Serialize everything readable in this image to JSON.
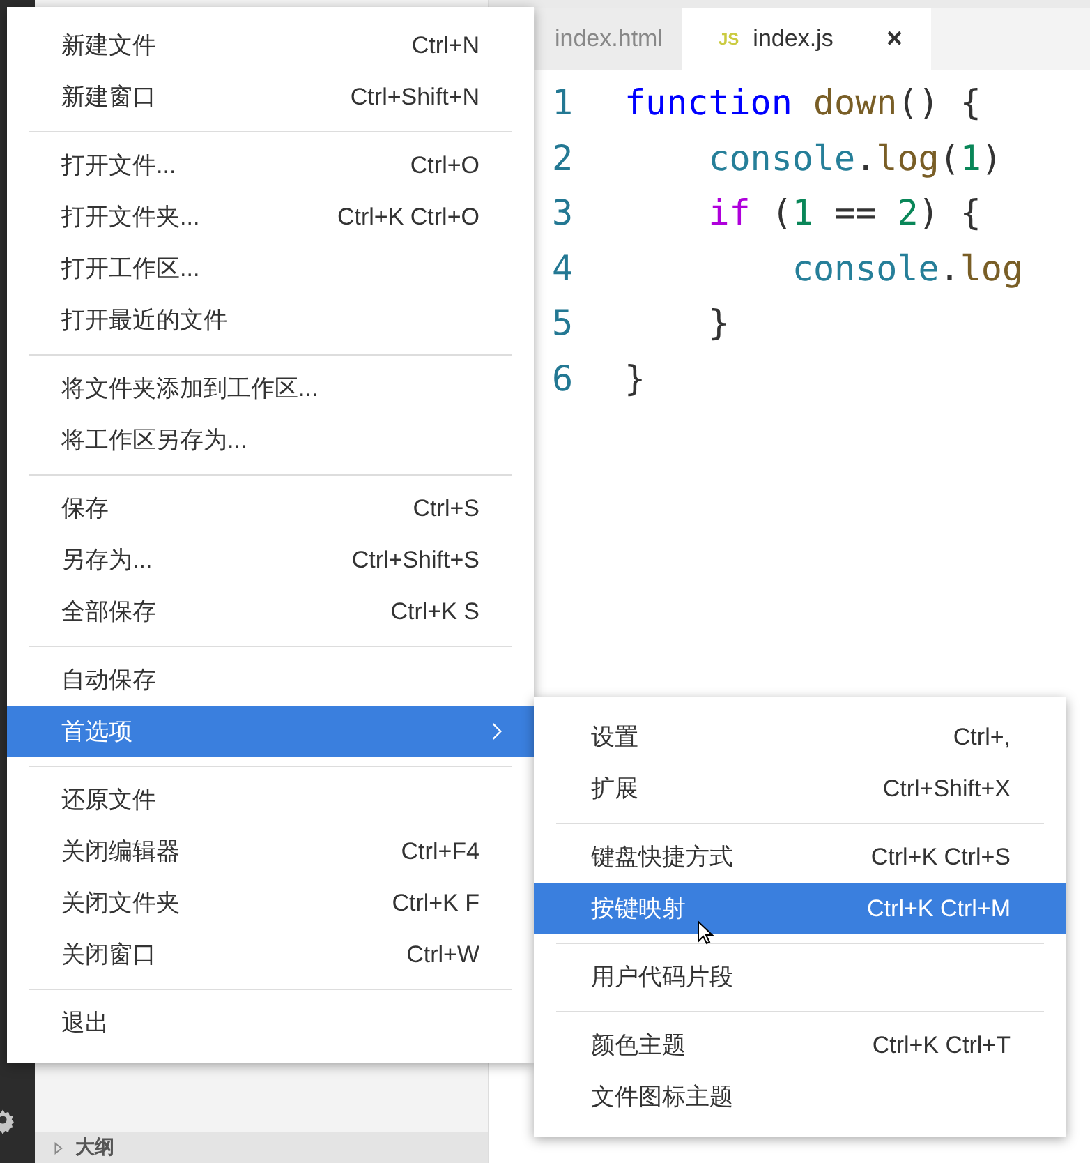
{
  "editor": {
    "tabs": [
      {
        "label": "index.html",
        "selected": false
      },
      {
        "badge": "JS",
        "label": "index.js",
        "selected": true,
        "close": "×"
      }
    ],
    "lines": [
      {
        "number": "1",
        "tokens": [
          {
            "kind": "keyword",
            "text": "function "
          },
          {
            "kind": "function",
            "text": "down"
          },
          {
            "kind": "punct",
            "text": "() {"
          }
        ]
      },
      {
        "number": "2",
        "tokens": [
          {
            "kind": "variable",
            "text": "    console"
          },
          {
            "kind": "punct",
            "text": "."
          },
          {
            "kind": "function",
            "text": "log"
          },
          {
            "kind": "punct",
            "text": "("
          },
          {
            "kind": "number",
            "text": "1"
          },
          {
            "kind": "punct",
            "text": ")"
          }
        ]
      },
      {
        "number": "3",
        "tokens": [
          {
            "kind": "control",
            "text": "    if"
          },
          {
            "kind": "punct",
            "text": " ("
          },
          {
            "kind": "number",
            "text": "1"
          },
          {
            "kind": "punct",
            "text": " == "
          },
          {
            "kind": "number",
            "text": "2"
          },
          {
            "kind": "punct",
            "text": ") {"
          }
        ]
      },
      {
        "number": "4",
        "tokens": [
          {
            "kind": "variable",
            "text": "        console"
          },
          {
            "kind": "punct",
            "text": "."
          },
          {
            "kind": "function",
            "text": "log"
          }
        ]
      },
      {
        "number": "5",
        "tokens": [
          {
            "kind": "punct",
            "text": "    }"
          }
        ]
      },
      {
        "number": "6",
        "tokens": [
          {
            "kind": "punct",
            "text": "}"
          }
        ]
      }
    ]
  },
  "sidebar": {
    "section": {
      "label": "大纲",
      "expanded": false
    }
  },
  "menu": {
    "groups": [
      [
        {
          "label": "新建文件",
          "shortcut": "Ctrl+N",
          "selected": false
        },
        {
          "label": "新建窗口",
          "shortcut": "Ctrl+Shift+N",
          "selected": false
        }
      ],
      [
        {
          "label": "打开文件...",
          "shortcut": "Ctrl+O",
          "selected": false
        },
        {
          "label": "打开文件夹...",
          "shortcut": "Ctrl+K Ctrl+O",
          "selected": false
        },
        {
          "label": "打开工作区...",
          "selected": false
        },
        {
          "label": "打开最近的文件",
          "selected": false
        }
      ],
      [
        {
          "label": "将文件夹添加到工作区...",
          "selected": false
        },
        {
          "label": "将工作区另存为...",
          "selected": false
        }
      ],
      [
        {
          "label": "保存",
          "shortcut": "Ctrl+S",
          "selected": false
        },
        {
          "label": "另存为...",
          "shortcut": "Ctrl+Shift+S",
          "selected": false
        },
        {
          "label": "全部保存",
          "shortcut": "Ctrl+K S",
          "selected": false
        }
      ],
      [
        {
          "label": "自动保存",
          "selected": false
        },
        {
          "label": "首选项",
          "selected": true,
          "submenu": true
        }
      ],
      [
        {
          "label": "还原文件",
          "selected": false
        },
        {
          "label": "关闭编辑器",
          "shortcut": "Ctrl+F4",
          "selected": false
        },
        {
          "label": "关闭文件夹",
          "shortcut": "Ctrl+K F",
          "selected": false
        },
        {
          "label": "关闭窗口",
          "shortcut": "Ctrl+W",
          "selected": false
        }
      ],
      [
        {
          "label": "退出",
          "selected": false
        }
      ]
    ]
  },
  "submenu": {
    "groups": [
      [
        {
          "label": "设置",
          "shortcut": "Ctrl+,",
          "selected": false
        },
        {
          "label": "扩展",
          "shortcut": "Ctrl+Shift+X",
          "selected": false
        }
      ],
      [
        {
          "label": "键盘快捷方式",
          "shortcut": "Ctrl+K Ctrl+S",
          "selected": false
        },
        {
          "label": "按键映射",
          "shortcut": "Ctrl+K Ctrl+M",
          "selected": true
        }
      ],
      [
        {
          "label": "用户代码片段",
          "selected": false
        }
      ],
      [
        {
          "label": "颜色主题",
          "shortcut": "Ctrl+K Ctrl+T",
          "selected": false
        },
        {
          "label": "文件图标主题",
          "selected": false
        }
      ]
    ]
  }
}
